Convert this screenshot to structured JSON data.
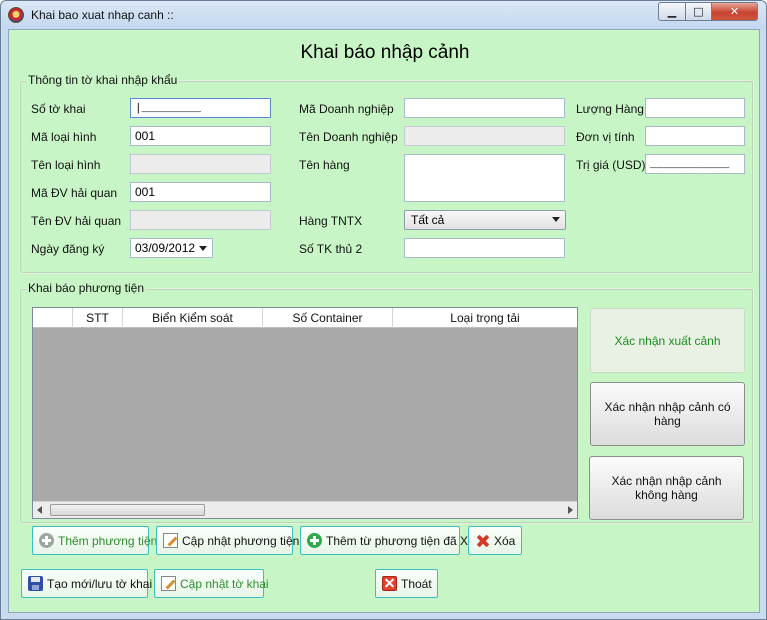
{
  "window": {
    "title": "Khai bao xuat nhap canh ::",
    "minimize_glyph": "▁",
    "maximize_glyph": "□",
    "close_glyph": "✕"
  },
  "heading": "Khai báo nhập cảnh",
  "declaration_group": {
    "title": "Thông tin tờ khai nhập khẩu",
    "so_to_khai": {
      "label": "Số tờ khai",
      "value": "",
      "mask": "|_________"
    },
    "ma_loai_hinh": {
      "label": "Mã loại hình",
      "value": "001"
    },
    "ten_loai_hinh": {
      "label": "Tên loại hình",
      "value": ""
    },
    "ma_dv_hai_quan": {
      "label": "Mã ĐV hải quan",
      "value": "001"
    },
    "ten_dv_hai_quan": {
      "label": "Tên ĐV hải quan",
      "value": ""
    },
    "ngay_dang_ky": {
      "label": "Ngày đăng ký",
      "value": "03/09/2012"
    },
    "ma_doanh_nghiep": {
      "label": "Mã Doanh nghiệp",
      "value": ""
    },
    "ten_doanh_nghiep": {
      "label": "Tên Doanh nghiệp",
      "value": ""
    },
    "ten_hang": {
      "label": "Tên hàng",
      "value": ""
    },
    "hang_tntx": {
      "label": "Hàng TNTX",
      "selected": "Tất cả"
    },
    "so_tk_thu_2": {
      "label": "Số TK thủ 2",
      "value": ""
    },
    "luong_hang": {
      "label": "Lượng Hàng",
      "value": ""
    },
    "don_vi_tinh": {
      "label": "Đơn vị tính",
      "value": ""
    },
    "tri_gia": {
      "label": "Trị giá (USD)",
      "value": "",
      "mask": "____________"
    }
  },
  "vehicle_group": {
    "title": "Khai báo phương tiện",
    "columns": [
      "",
      "STT",
      "Biển Kiểm soát",
      "Số Container",
      "Loại trọng tải"
    ]
  },
  "side_buttons": {
    "xac_nhan_xuat_canh": "Xác nhận xuất cảnh",
    "xac_nhan_nhap_canh_co_hang": "Xác nhận nhập cảnh có hàng",
    "xac_nhan_nhap_canh_khong_hang": "Xác nhận nhập cảnh không hàng"
  },
  "vehicle_buttons": {
    "them": "Thêm phương tiện",
    "cap_nhat": "Cập nhật phương tiện",
    "them_tu_xk": "Thêm từ phương tiện đã XK",
    "xoa": "Xóa"
  },
  "bottom_buttons": {
    "tao_moi": "Tạo mới/lưu tờ khai",
    "cap_nhat_to_khai": "Cập nhật tờ khai",
    "thoat": "Thoát"
  },
  "colors": {
    "client_bg": "#c8f5c6",
    "title_bg": "#c3d7ee",
    "accent_green": "#1b8f1b"
  }
}
